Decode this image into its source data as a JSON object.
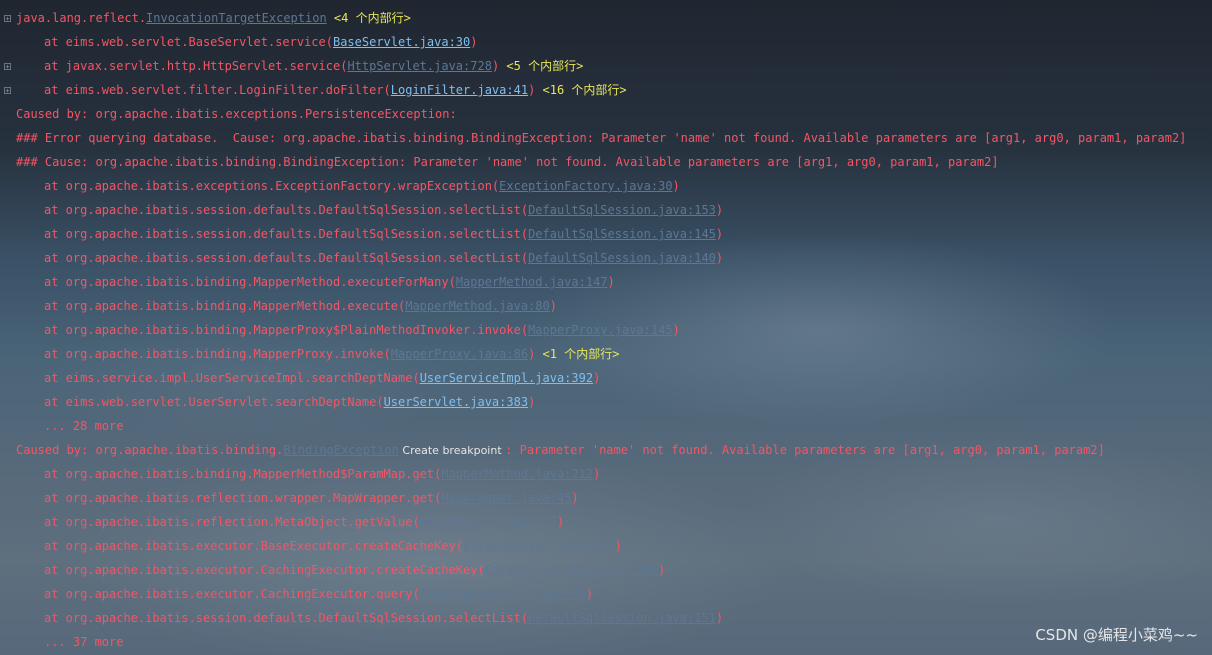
{
  "console": {
    "l1": {
      "pre": "java.lang.reflect.",
      "link": "InvocationTargetException",
      "note": " <4 个内部行>"
    },
    "l2": {
      "pre": "at eims.web.servlet.BaseServlet.service(",
      "link": "BaseServlet.java:30",
      "post": ")"
    },
    "l3": {
      "pre": "at javax.servlet.http.HttpServlet.service(",
      "link": "HttpServlet.java:728",
      "post": ")",
      "note": " <5 个内部行>"
    },
    "l4": {
      "pre": "at eims.web.servlet.filter.LoginFilter.doFilter(",
      "link": "LoginFilter.java:41",
      "post": ")",
      "note": " <16 个内部行>"
    },
    "l5": {
      "text": "Caused by: org.apache.ibatis.exceptions.PersistenceException:"
    },
    "l6": {
      "text": "### Error querying database.  Cause: org.apache.ibatis.binding.BindingException: Parameter 'name' not found. Available parameters are [arg1, arg0, param1, param2]"
    },
    "l7": {
      "text": "### Cause: org.apache.ibatis.binding.BindingException: Parameter 'name' not found. Available parameters are [arg1, arg0, param1, param2]"
    },
    "l8": {
      "pre": "at org.apache.ibatis.exceptions.ExceptionFactory.wrapException(",
      "link": "ExceptionFactory.java:30",
      "post": ")"
    },
    "l9": {
      "pre": "at org.apache.ibatis.session.defaults.DefaultSqlSession.selectList(",
      "link": "DefaultSqlSession.java:153",
      "post": ")"
    },
    "l10": {
      "pre": "at org.apache.ibatis.session.defaults.DefaultSqlSession.selectList(",
      "link": "DefaultSqlSession.java:145",
      "post": ")"
    },
    "l11": {
      "pre": "at org.apache.ibatis.session.defaults.DefaultSqlSession.selectList(",
      "link": "DefaultSqlSession.java:140",
      "post": ")"
    },
    "l12": {
      "pre": "at org.apache.ibatis.binding.MapperMethod.executeForMany(",
      "link": "MapperMethod.java:147",
      "post": ")"
    },
    "l13": {
      "pre": "at org.apache.ibatis.binding.MapperMethod.execute(",
      "link": "MapperMethod.java:80",
      "post": ")"
    },
    "l14": {
      "pre": "at org.apache.ibatis.binding.MapperProxy$PlainMethodInvoker.invoke(",
      "link": "MapperProxy.java:145",
      "post": ")"
    },
    "l15": {
      "pre": "at org.apache.ibatis.binding.MapperProxy.invoke(",
      "link": "MapperProxy.java:86",
      "post": ")",
      "note": " <1 个内部行>"
    },
    "l16": {
      "pre": "at eims.service.impl.UserServiceImpl.searchDeptName(",
      "link": "UserServiceImpl.java:392",
      "post": ")"
    },
    "l17": {
      "pre": "at eims.web.servlet.UserServlet.searchDeptName(",
      "link": "UserServlet.java:383",
      "post": ")"
    },
    "l18": {
      "text": "... 28 more"
    },
    "l19": {
      "pre": "Caused by: org.apache.ibatis.binding.",
      "link": "BindingException",
      "tooltip": " Create breakpoint ",
      "post": ": Parameter 'name' not found. Available parameters are [arg1, arg0, param1, param2]"
    },
    "l20": {
      "pre": "at org.apache.ibatis.binding.MapperMethod$ParamMap.get(",
      "link": "MapperMethod.java:212",
      "post": ")"
    },
    "l21": {
      "pre": "at org.apache.ibatis.reflection.wrapper.MapWrapper.get(",
      "link": "MapWrapper.java:45",
      "post": ")"
    },
    "l22": {
      "pre": "at org.apache.ibatis.reflection.MetaObject.getValue(",
      "link": "MetaObject.java:122",
      "post": ")"
    },
    "l23": {
      "pre": "at org.apache.ibatis.executor.BaseExecutor.createCacheKey(",
      "link": "BaseExecutor.java:219",
      "post": ")"
    },
    "l24": {
      "pre": "at org.apache.ibatis.executor.CachingExecutor.createCacheKey(",
      "link": "CachingExecutor.java:146",
      "post": ")"
    },
    "l25": {
      "pre": "at org.apache.ibatis.executor.CachingExecutor.query(",
      "link": "CachingExecutor.java:88",
      "post": ")"
    },
    "l26": {
      "pre": "at org.apache.ibatis.session.defaults.DefaultSqlSession.selectList(",
      "link": "DefaultSqlSession.java:151",
      "post": ")"
    },
    "l27": {
      "text": "... 37 more"
    }
  },
  "fold_glyph": "+",
  "watermark": "CSDN @编程小菜鸡~~"
}
